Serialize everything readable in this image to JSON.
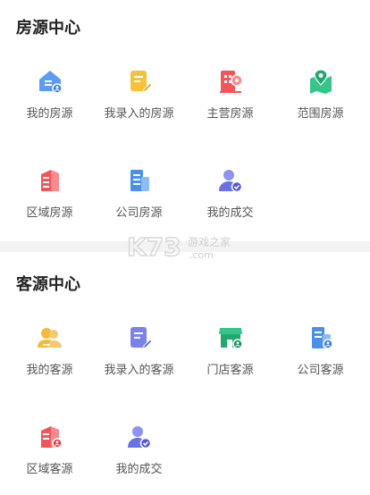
{
  "sections": {
    "house": {
      "title": "房源中心",
      "items": [
        {
          "label": "我的房源",
          "icon": "house-person-icon"
        },
        {
          "label": "我录入的房源",
          "icon": "document-edit-icon"
        },
        {
          "label": "主营房源",
          "icon": "building-pin-icon"
        },
        {
          "label": "范围房源",
          "icon": "map-pin-icon"
        },
        {
          "label": "区域房源",
          "icon": "region-building-icon"
        },
        {
          "label": "公司房源",
          "icon": "company-building-icon"
        },
        {
          "label": "我的成交",
          "icon": "user-check-icon"
        }
      ]
    },
    "client": {
      "title": "客源中心",
      "items": [
        {
          "label": "我的客源",
          "icon": "users-icon"
        },
        {
          "label": "我录入的客源",
          "icon": "document-edit-icon"
        },
        {
          "label": "门店客源",
          "icon": "store-icon"
        },
        {
          "label": "公司客源",
          "icon": "company-person-icon"
        },
        {
          "label": "区域客源",
          "icon": "region-person-icon"
        },
        {
          "label": "我的成交",
          "icon": "user-check-icon"
        }
      ]
    }
  },
  "watermark": {
    "text": "K73",
    "sub": "游戏之家",
    "domain": ".com"
  }
}
